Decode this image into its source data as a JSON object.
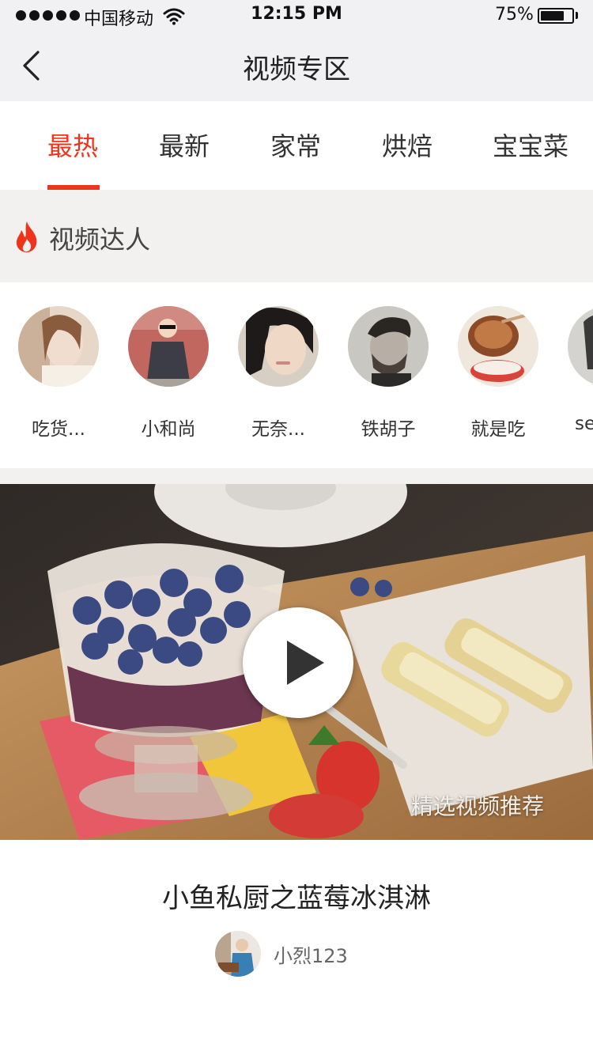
{
  "status_bar": {
    "carrier": "中国移动",
    "time": "12:15 PM",
    "battery_text": "75%",
    "battery_level": 0.75
  },
  "nav": {
    "title": "视频专区",
    "back_icon": "chevron-left-icon"
  },
  "tabs": [
    {
      "label": "最热",
      "active": true
    },
    {
      "label": "最新",
      "active": false
    },
    {
      "label": "家常",
      "active": false
    },
    {
      "label": "烘焙",
      "active": false
    },
    {
      "label": "宝宝菜",
      "active": false
    }
  ],
  "section": {
    "title": "视频达人",
    "icon": "fire-icon",
    "accent": "#f0341c"
  },
  "creators": [
    {
      "name": "吃货..."
    },
    {
      "name": "小和尚"
    },
    {
      "name": "无奈..."
    },
    {
      "name": "铁胡子"
    },
    {
      "name": "就是吃"
    },
    {
      "name": "se"
    }
  ],
  "video": {
    "tag": "精选视频推荐",
    "title": "小鱼私厨之蓝莓冰淇淋",
    "play_icon": "play-icon"
  },
  "author": {
    "name": "小烈123"
  }
}
